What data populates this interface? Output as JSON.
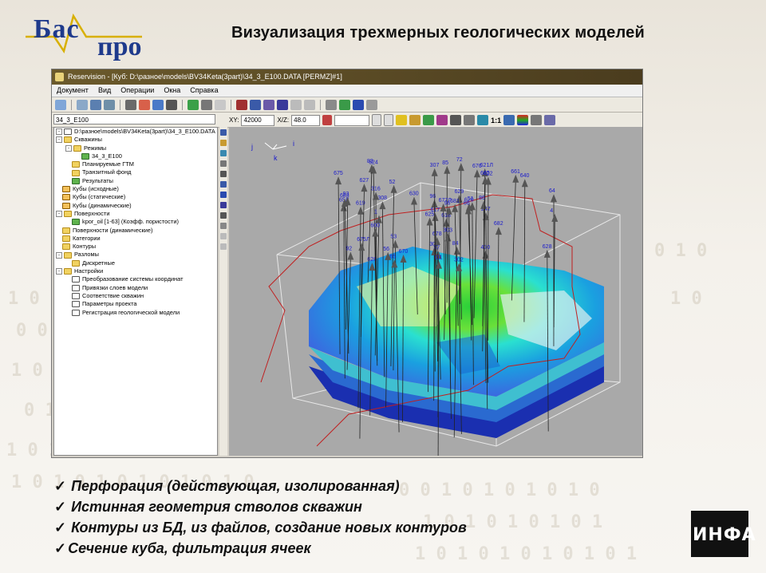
{
  "slide": {
    "title": "Визуализация трехмерных геологических моделей",
    "logo": {
      "part1": "Бас",
      "part2": "про"
    },
    "stamp": "ИНФА"
  },
  "window": {
    "title": "Reservision - [Куб: D:\\разное\\models\\BV34Keta(3part)\\34_3_E100.DATA [PERMZ]#1]",
    "menu": [
      "Документ",
      "Вид",
      "Операции",
      "Окна",
      "Справка"
    ],
    "tree_combo": "34_3_E100",
    "xy_label": "XY:",
    "xy_value": "42000",
    "xz_label": "X/Z:",
    "xz_value": "48.0",
    "scale_label": "1:1",
    "tree": [
      {
        "label": "D:\\разное\\models\\BV34Keta(3part)\\34_3_E100.DATA",
        "indent": 0,
        "icon": "doc",
        "pm": "-"
      },
      {
        "label": "Скважины",
        "indent": 0,
        "icon": "folder",
        "pm": "-"
      },
      {
        "label": "Режимы",
        "indent": 1,
        "icon": "folder",
        "pm": "-"
      },
      {
        "label": "34_3_E100",
        "indent": 2,
        "icon": "green",
        "pm": ""
      },
      {
        "label": "Планируемые ГТМ",
        "indent": 1,
        "icon": "folder",
        "pm": ""
      },
      {
        "label": "Транзитный фонд",
        "indent": 1,
        "icon": "folder",
        "pm": ""
      },
      {
        "label": "Результаты",
        "indent": 1,
        "icon": "green",
        "pm": ""
      },
      {
        "label": "Кубы (исходные)",
        "indent": 0,
        "icon": "cube",
        "pm": ""
      },
      {
        "label": "Кубы (статические)",
        "indent": 0,
        "icon": "cube",
        "pm": ""
      },
      {
        "label": "Кубы (динамические)",
        "indent": 0,
        "icon": "cube",
        "pm": ""
      },
      {
        "label": "Поверхности",
        "indent": 0,
        "icon": "folder",
        "pm": "-"
      },
      {
        "label": "kpor_oil [1-63] (Коэфф. пористости)",
        "indent": 1,
        "icon": "green",
        "pm": ""
      },
      {
        "label": "Поверхности (динамические)",
        "indent": 0,
        "icon": "folder",
        "pm": ""
      },
      {
        "label": "Категории",
        "indent": 0,
        "icon": "folder",
        "pm": ""
      },
      {
        "label": "Контуры",
        "indent": 0,
        "icon": "folder",
        "pm": ""
      },
      {
        "label": "Разломы",
        "indent": 0,
        "icon": "folder",
        "pm": "-"
      },
      {
        "label": "Дискретные",
        "indent": 1,
        "icon": "folder",
        "pm": ""
      },
      {
        "label": "Настройки",
        "indent": 0,
        "icon": "folder",
        "pm": "-"
      },
      {
        "label": "Преобразование системы координат",
        "indent": 1,
        "icon": "doc",
        "pm": ""
      },
      {
        "label": "Привязки слоев модели",
        "indent": 1,
        "icon": "doc",
        "pm": ""
      },
      {
        "label": "Соответствие скважин",
        "indent": 1,
        "icon": "doc",
        "pm": ""
      },
      {
        "label": "Параметры проекта",
        "indent": 1,
        "icon": "doc",
        "pm": ""
      },
      {
        "label": "Регистрация геологической модели",
        "indent": 1,
        "icon": "doc",
        "pm": ""
      }
    ],
    "axes": [
      "j",
      "k",
      "i"
    ],
    "wells": [
      "618",
      "617",
      "620",
      "621Л",
      "622",
      "624",
      "619",
      "625",
      "626",
      "629",
      "630",
      "56",
      "51",
      "627",
      "65Л",
      "64",
      "302",
      "52",
      "53",
      "628",
      "72",
      "308",
      "65",
      "66",
      "57",
      "675Л",
      "675",
      "430",
      "83",
      "84",
      "85",
      "93",
      "661",
      "676",
      "677Л",
      "678",
      "682",
      "92",
      "316",
      "96",
      "681",
      "247",
      "111",
      "303",
      "302",
      "307",
      "86",
      "96",
      "683",
      "665",
      "1",
      "4",
      "600",
      "670",
      "640"
    ]
  },
  "bullets": [
    {
      "check": "✓",
      "text": "Перфорация (действующая, изолированная)"
    },
    {
      "check": "✓",
      "text": "Истинная геометрия стволов скважин"
    },
    {
      "check": "✓",
      "text": "Контуры из БД, из файлов, создание новых контуров"
    },
    {
      "check": "✓",
      "text": "Сечение куба, фильтрация ячеек"
    }
  ]
}
